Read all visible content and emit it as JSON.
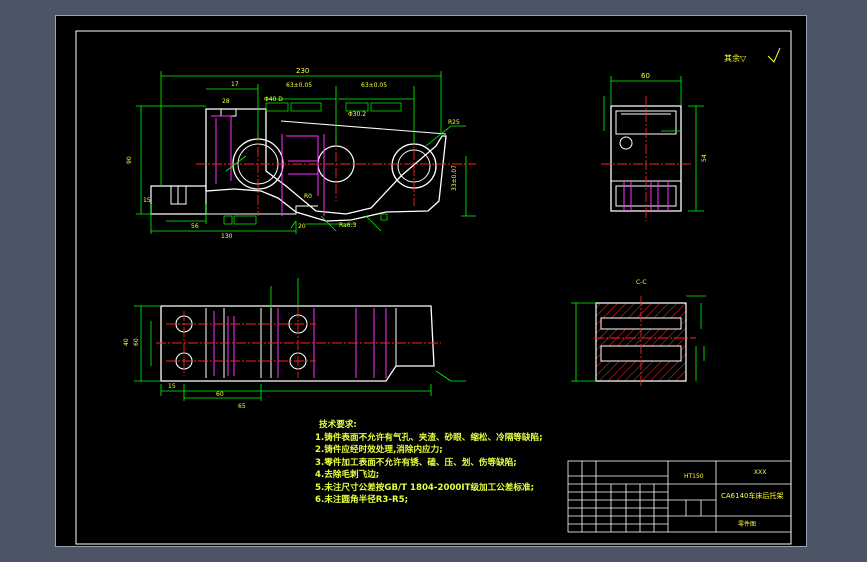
{
  "corner_mark": "其余▽",
  "technical_requirements": {
    "heading": "技术要求:",
    "lines": [
      "1.铸件表面不允许有气孔、夹渣、砂眼、缩松、冷隔等缺陷;",
      "2.铸件应经时效处理,消除内应力;",
      "3.零件加工表面不允许有锈、磕、压、划、伤等缺陷;",
      "4.去除毛刺飞边;",
      "5.未注尺寸公差按GB/T 1804-2000IT级加工公差标准;",
      "6.未注圆角半径R3-R5;"
    ]
  },
  "title_block": {
    "material": "HT150",
    "drawing_name": "CA6140车床后托架",
    "school": "XXX",
    "drawing_type": "零件图"
  },
  "section_label": "C-C",
  "front_view_dims": {
    "overall": "230",
    "a": "17",
    "b": "63±0.05",
    "c": "63±0.05",
    "d": "28",
    "e": "Φ40 D",
    "f": "Φ30.2",
    "g": "R25",
    "h": "90",
    "i": "15",
    "j": "56",
    "k": "130",
    "l": "20",
    "m": "R0",
    "n": "Ra6.3",
    "o": "33±0.07"
  },
  "side_view_dims": {
    "width": "60",
    "height": "54"
  },
  "top_view_dims": {
    "width": "40",
    "height": "60",
    "a": "15",
    "b": "60",
    "c": "65"
  },
  "colors": {
    "outline": "#ffffff",
    "dimension": "#00ff00",
    "center": "#ff2020",
    "hidden": "#ff30ff",
    "hatch": "#ff3030",
    "text": "#ffff33"
  }
}
